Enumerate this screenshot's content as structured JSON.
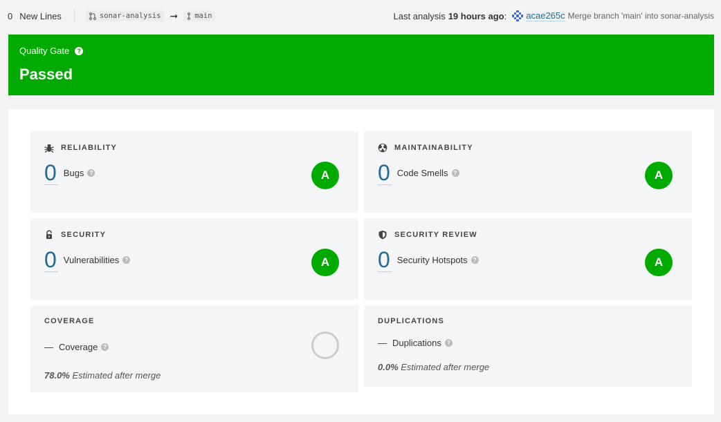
{
  "topbar": {
    "new_lines_count": "0",
    "new_lines_label": "New Lines",
    "source_branch": "sonar-analysis",
    "target_branch": "main",
    "last_analysis_label": "Last analysis",
    "last_analysis_time": "19 hours ago",
    "colon": ":",
    "commit_hash": "acae265c",
    "commit_message": "Merge branch 'main' into sonar-analysis"
  },
  "quality_gate": {
    "label": "Quality Gate",
    "status": "Passed",
    "color": "#00aa00"
  },
  "cards": {
    "reliability": {
      "title": "RELIABILITY",
      "value": "0",
      "label": "Bugs",
      "rating": "A",
      "icon": "bug-icon"
    },
    "maintainability": {
      "title": "MAINTAINABILITY",
      "value": "0",
      "label": "Code Smells",
      "rating": "A",
      "icon": "radiation-icon"
    },
    "security": {
      "title": "SECURITY",
      "value": "0",
      "label": "Vulnerabilities",
      "rating": "A",
      "icon": "lock-icon"
    },
    "security_review": {
      "title": "SECURITY REVIEW",
      "value": "0",
      "label": "Security Hotspots",
      "rating": "A",
      "icon": "shield-icon"
    },
    "coverage": {
      "title": "COVERAGE",
      "value": "—",
      "label": "Coverage",
      "estimate_value": "78.0%",
      "estimate_text": "Estimated after merge"
    },
    "duplications": {
      "title": "DUPLICATIONS",
      "value": "—",
      "label": "Duplications",
      "estimate_value": "0.0%",
      "estimate_text": "Estimated after merge"
    }
  },
  "colors": {
    "rating_a": "#00aa00",
    "link": "#236a97"
  }
}
